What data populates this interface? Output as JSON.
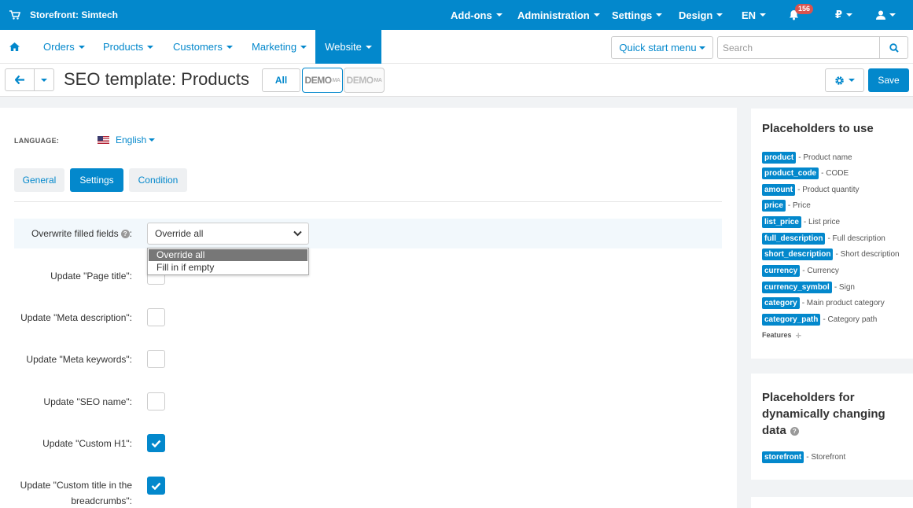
{
  "topbar": {
    "store_name": "Storefront: Simtech",
    "addons": "Add-ons",
    "administration": "Administration",
    "settings": "Settings",
    "design": "Design",
    "language": "EN",
    "notifications_count": "156",
    "currency": "₽"
  },
  "nav": {
    "orders": "Orders",
    "products": "Products",
    "customers": "Customers",
    "marketing": "Marketing",
    "website": "Website",
    "quick_start": "Quick start menu",
    "search_placeholder": "Search"
  },
  "titlebar": {
    "title": "SEO template: Products",
    "all": "All",
    "store1": "DEMO",
    "store1_sup": "MA",
    "store2": "DEMO",
    "store2_sup": "MA",
    "save": "Save"
  },
  "form": {
    "language_label": "LANGUAGE:",
    "language_value": "English",
    "tabs": [
      "General",
      "Settings",
      "Condition"
    ],
    "overwrite_label": "Overwrite filled fields",
    "overwrite_value": "Override all",
    "overwrite_options": [
      "Override all",
      "Fill in if empty"
    ],
    "fields": [
      {
        "label": "Update \"Page title\":",
        "checked": false
      },
      {
        "label": "Update \"Meta description\":",
        "checked": false
      },
      {
        "label": "Update \"Meta keywords\":",
        "checked": false
      },
      {
        "label": "Update \"SEO name\":",
        "checked": false
      },
      {
        "label": "Update \"Custom H1\":",
        "checked": true
      },
      {
        "label_line1": "Update \"Custom title in the",
        "label_line2": "breadcrumbs\":",
        "checked": true
      }
    ]
  },
  "sidebar": {
    "placeholders_title": "Placeholders to use",
    "placeholders": [
      {
        "tag": "product",
        "desc": "- Product name"
      },
      {
        "tag": "product_code",
        "desc": "- CODE"
      },
      {
        "tag": "amount",
        "desc": "- Product quantity"
      },
      {
        "tag": "price",
        "desc": "- Price"
      },
      {
        "tag": "list_price",
        "desc": "- List price"
      },
      {
        "tag": "full_description",
        "desc": "- Full description"
      },
      {
        "tag": "short_description",
        "desc": "- Short description"
      },
      {
        "tag": "currency",
        "desc": "- Currency"
      },
      {
        "tag": "currency_symbol",
        "desc": "- Sign"
      },
      {
        "tag": "category",
        "desc": "- Main product category"
      },
      {
        "tag": "category_path",
        "desc": "- Category path"
      }
    ],
    "features": "Features",
    "dynamic_title_1": "Placeholders for",
    "dynamic_title_2": "dynamically changing",
    "dynamic_title_3": "data",
    "dynamic_placeholders": [
      {
        "tag": "storefront",
        "desc": "- Storefront"
      }
    ]
  },
  "colors": {
    "accent": "#0388cc",
    "badge": "#d9534f"
  }
}
